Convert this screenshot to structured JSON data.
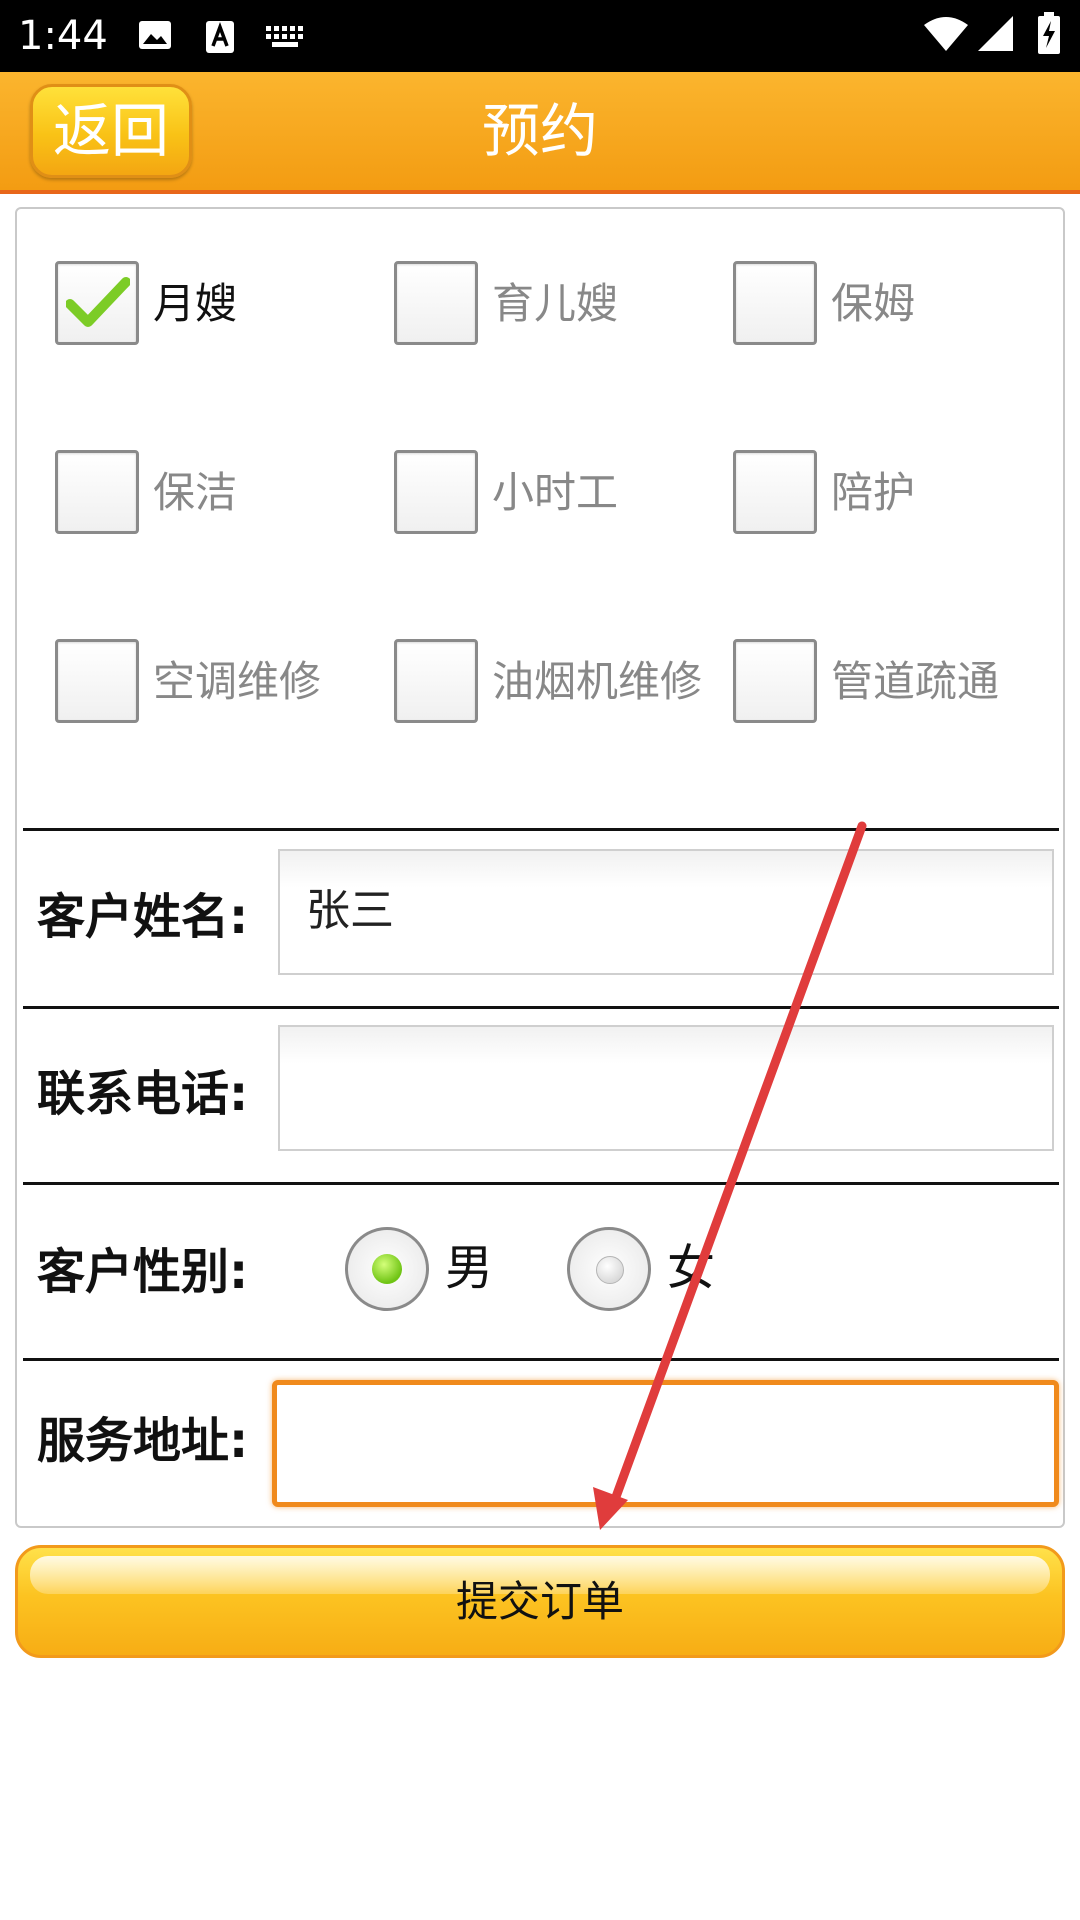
{
  "status_bar": {
    "time": "1:44",
    "icons": [
      "image-icon",
      "text-a-icon",
      "keyboard-icon",
      "wifi-icon",
      "signal-icon",
      "battery-charging-icon"
    ]
  },
  "header": {
    "back_label": "返回",
    "title": "预约",
    "color": "#f5a623"
  },
  "services": [
    {
      "label": "月嫂",
      "checked": true
    },
    {
      "label": "育儿嫂",
      "checked": false
    },
    {
      "label": "保姆",
      "checked": false
    },
    {
      "label": "保洁",
      "checked": false
    },
    {
      "label": "小时工",
      "checked": false
    },
    {
      "label": "陪护",
      "checked": false
    },
    {
      "label": "空调维修",
      "checked": false
    },
    {
      "label": "油烟机维修",
      "checked": false
    },
    {
      "label": "管道疏通",
      "checked": false
    }
  ],
  "form": {
    "name_label": "客户姓名:",
    "name_value": "张三",
    "phone_label": "联系电话:",
    "phone_value": "",
    "gender_label": "客户性别:",
    "gender_options": [
      {
        "label": "男",
        "selected": true
      },
      {
        "label": "女",
        "selected": false
      }
    ],
    "address_label": "服务地址:",
    "address_value": ""
  },
  "submit_label": "提交订单",
  "accent_color": "#f08a1c"
}
